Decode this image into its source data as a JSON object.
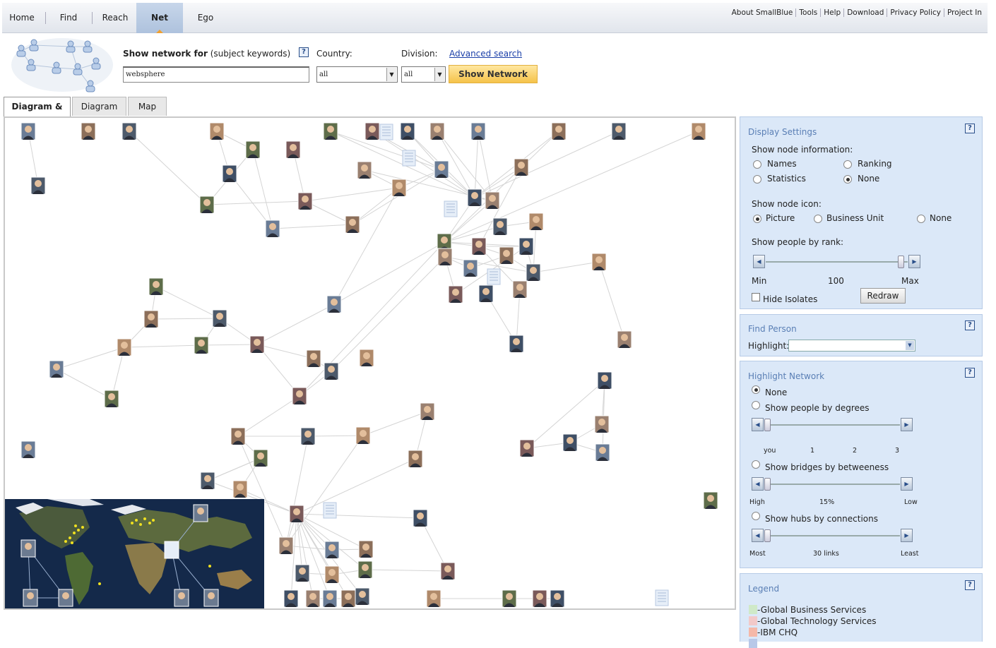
{
  "nav": {
    "tabs": [
      {
        "label": "Home",
        "active": false
      },
      {
        "label": "Find",
        "active": false
      },
      {
        "label": "Reach",
        "active": false
      },
      {
        "label": "Net",
        "active": true
      },
      {
        "label": "Ego",
        "active": false
      }
    ],
    "links": [
      "About SmallBlue",
      "Tools",
      "Help",
      "Download",
      "Privacy Policy",
      "Project In"
    ]
  },
  "search": {
    "show_network_bold": "Show network for",
    "show_network_rest": " (subject keywords)",
    "keyword_value": "websphere",
    "country_label": "Country:",
    "country_value": "all",
    "division_label": "Division:",
    "division_value": "all",
    "advanced_link": "Advanced search",
    "show_button": "Show Network"
  },
  "view_tabs": [
    {
      "label": "Diagram & Map",
      "active": true
    },
    {
      "label": "Diagram only",
      "active": false
    },
    {
      "label": "Map only",
      "active": false
    }
  ],
  "display_settings": {
    "title": "Display Settings",
    "node_info_label": "Show node information:",
    "node_info_options": [
      "Names",
      "Ranking",
      "Statistics",
      "None"
    ],
    "node_info_selected": "None",
    "node_icon_label": "Show node icon:",
    "node_icon_options": [
      "Picture",
      "Business Unit",
      "None"
    ],
    "node_icon_selected": "Picture",
    "rank_label": "Show people by rank:",
    "rank_min": "Min",
    "rank_value": "100",
    "rank_max": "Max",
    "hide_isolates": "Hide Isolates",
    "hide_isolates_checked": false,
    "redraw": "Redraw"
  },
  "find_person": {
    "title": "Find Person",
    "highlight_label": "Highlight:",
    "highlight_value": ""
  },
  "highlight_network": {
    "title": "Highlight Network",
    "none": "None",
    "degrees": "Show people by degrees",
    "degree_ticks": [
      "you",
      "1",
      "2",
      "3"
    ],
    "bridges": "Show bridges by betweeness",
    "bridge_high": "High",
    "bridge_value": "15%",
    "bridge_low": "Low",
    "hubs": "Show hubs by connections",
    "hub_most": "Most",
    "hub_value": "30 links",
    "hub_least": "Least",
    "selected": "None"
  },
  "legend": {
    "title": "Legend",
    "items": [
      {
        "label": "-Global Business Services",
        "color": "#cfe9c8"
      },
      {
        "label": "-Global Technology Services",
        "color": "#f2c9c9"
      },
      {
        "label": "-IBM CHQ",
        "color": "#f5b8a8"
      }
    ]
  },
  "colors": {
    "accent_blue": "#1a3fa8",
    "panel_bg": "#dbe8f8",
    "show_button": "#f5c34a",
    "edge": "#d4d4d4"
  },
  "help_icon": "?"
}
